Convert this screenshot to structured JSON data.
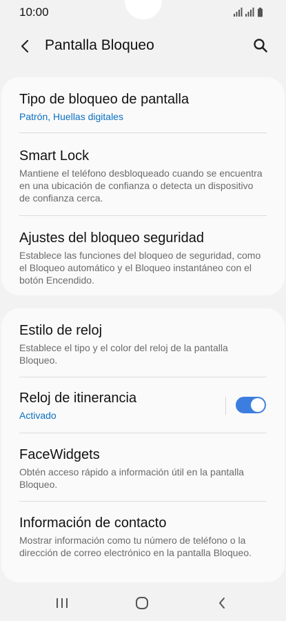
{
  "status_bar": {
    "time": "10:00",
    "icons": [
      "signal-icon",
      "signal-icon",
      "battery-icon"
    ]
  },
  "app_bar": {
    "title": "Pantalla Bloqueo",
    "back_icon": "chevron-left-icon",
    "search_icon": "search-icon"
  },
  "section1": {
    "items": [
      {
        "title": "Tipo de bloqueo de pantalla",
        "subtitle": "Patrón, Huellas digitales"
      },
      {
        "title": "Smart Lock",
        "subtitle": "Mantiene el teléfono desbloqueado cuando se encuentra en una ubicación de confianza o detecta un dispositivo de confianza cerca."
      },
      {
        "title": "Ajustes del bloqueo seguridad",
        "subtitle": "Establece las funciones del bloqueo de seguridad, como el Bloqueo automático y el Bloqueo instantáneo con el botón Encendido."
      }
    ]
  },
  "section2": {
    "items": [
      {
        "title": "Estilo de reloj",
        "subtitle": "Establece el tipo y el color del reloj de la pantalla Bloqueo."
      },
      {
        "title": "Reloj de itinerancia",
        "subtitle": "Activado",
        "toggle_on": true
      },
      {
        "title": "FaceWidgets",
        "subtitle": "Obtén acceso rápido a información útil en la pantalla Bloqueo."
      },
      {
        "title": "Información de contacto",
        "subtitle": "Mostrar información como tu número de teléfono o la dirección de correo electrónico en la pantalla Bloqueo."
      }
    ]
  },
  "nav_bar": {
    "icons": [
      "recent-apps-icon",
      "home-icon",
      "back-icon"
    ]
  },
  "colors": {
    "accent": "#0a6fc2",
    "toggle": "#3c7ee0",
    "background": "#f2f2f2",
    "card": "#fafafa"
  }
}
